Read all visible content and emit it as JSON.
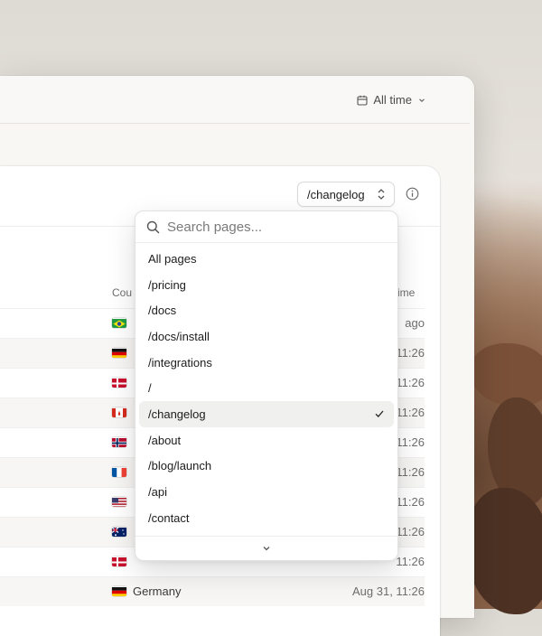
{
  "header": {
    "time_filter_label": "All time"
  },
  "card": {
    "selected_page": "/changelog"
  },
  "table": {
    "country_header": "Cou",
    "time_header": "ime",
    "rows": [
      {
        "country": "",
        "flag": "brazil",
        "time": "ago"
      },
      {
        "country": "",
        "flag": "germany",
        "time": "11:26"
      },
      {
        "country": "",
        "flag": "denmark",
        "time": "11:26"
      },
      {
        "country": "",
        "flag": "canada",
        "time": "11:26"
      },
      {
        "country": "",
        "flag": "norway",
        "time": "11:26"
      },
      {
        "country": "",
        "flag": "france",
        "time": "11:26"
      },
      {
        "country": "",
        "flag": "usa",
        "time": "11:26"
      },
      {
        "country": "",
        "flag": "australia",
        "time": "11:26"
      },
      {
        "country": "",
        "flag": "denmark",
        "time": "11:26"
      },
      {
        "country": "Germany",
        "flag": "germany",
        "time": "Aug 31, 11:26"
      }
    ]
  },
  "dropdown": {
    "search_placeholder": "Search pages...",
    "options": [
      "All pages",
      "/pricing",
      "/docs",
      "/docs/install",
      "/integrations",
      "/",
      "/changelog",
      "/about",
      "/blog/launch",
      "/api",
      "/contact"
    ],
    "selected": "/changelog"
  },
  "icons": {
    "calendar": "calendar-icon",
    "chevron": "chevron-down-icon",
    "select": "up-down-chevrons-icon",
    "info": "info-icon",
    "search": "search-icon",
    "check": "check-icon"
  }
}
